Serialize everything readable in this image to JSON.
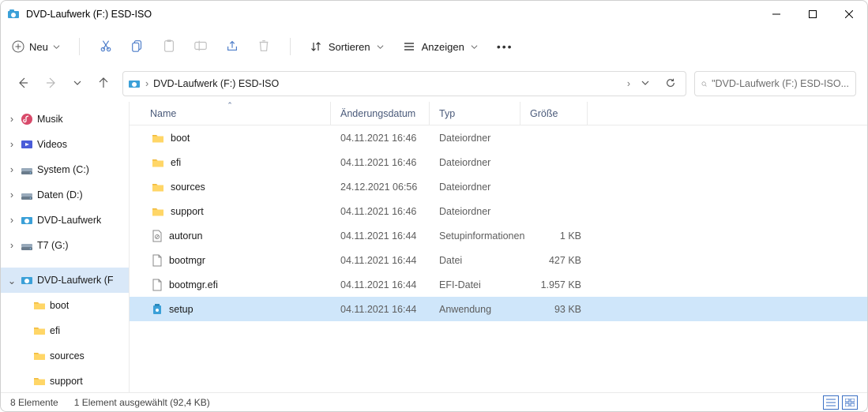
{
  "window": {
    "title": "DVD-Laufwerk (F:) ESD-ISO"
  },
  "toolbar": {
    "new_label": "Neu",
    "sort_label": "Sortieren",
    "view_label": "Anzeigen"
  },
  "addressbar": {
    "path": "DVD-Laufwerk (F:) ESD-ISO",
    "sep": "›"
  },
  "searchbox": {
    "placeholder": "\"DVD-Laufwerk (F:) ESD-ISO..."
  },
  "navpane": {
    "items": [
      {
        "label": "Musik",
        "chev": "›",
        "kind": "music"
      },
      {
        "label": "Videos",
        "chev": "›",
        "kind": "videos"
      },
      {
        "label": "System (C:)",
        "chev": "›",
        "kind": "drive"
      },
      {
        "label": "Daten (D:)",
        "chev": "›",
        "kind": "drive"
      },
      {
        "label": "DVD-Laufwerk",
        "chev": "›",
        "kind": "dvd"
      },
      {
        "label": "T7 (G:)",
        "chev": "›",
        "kind": "drive"
      },
      {
        "label": "DVD-Laufwerk (F",
        "chev": "⌄",
        "kind": "dvd",
        "selected": true
      },
      {
        "label": "boot",
        "chev": "",
        "kind": "folder",
        "child": true,
        "selected_child": true
      },
      {
        "label": "efi",
        "chev": "",
        "kind": "folder",
        "child": true
      },
      {
        "label": "sources",
        "chev": "",
        "kind": "folder",
        "child": true
      },
      {
        "label": "support",
        "chev": "",
        "kind": "folder",
        "child": true
      }
    ]
  },
  "columns": {
    "name": "Name",
    "date": "Änderungsdatum",
    "type": "Typ",
    "size": "Größe"
  },
  "rows": [
    {
      "name": "boot",
      "date": "04.11.2021 16:46",
      "type": "Dateiordner",
      "size": "",
      "icon": "folder"
    },
    {
      "name": "efi",
      "date": "04.11.2021 16:46",
      "type": "Dateiordner",
      "size": "",
      "icon": "folder"
    },
    {
      "name": "sources",
      "date": "24.12.2021 06:56",
      "type": "Dateiordner",
      "size": "",
      "icon": "folder"
    },
    {
      "name": "support",
      "date": "04.11.2021 16:46",
      "type": "Dateiordner",
      "size": "",
      "icon": "folder"
    },
    {
      "name": "autorun",
      "date": "04.11.2021 16:44",
      "type": "Setupinformationen",
      "size": "1 KB",
      "icon": "inf"
    },
    {
      "name": "bootmgr",
      "date": "04.11.2021 16:44",
      "type": "Datei",
      "size": "427 KB",
      "icon": "file"
    },
    {
      "name": "bootmgr.efi",
      "date": "04.11.2021 16:44",
      "type": "EFI-Datei",
      "size": "1.957 KB",
      "icon": "file"
    },
    {
      "name": "setup",
      "date": "04.11.2021 16:44",
      "type": "Anwendung",
      "size": "93 KB",
      "icon": "setup",
      "selected": true
    }
  ],
  "statusbar": {
    "count": "8 Elemente",
    "selection": "1 Element ausgewählt (92,4 KB)"
  }
}
